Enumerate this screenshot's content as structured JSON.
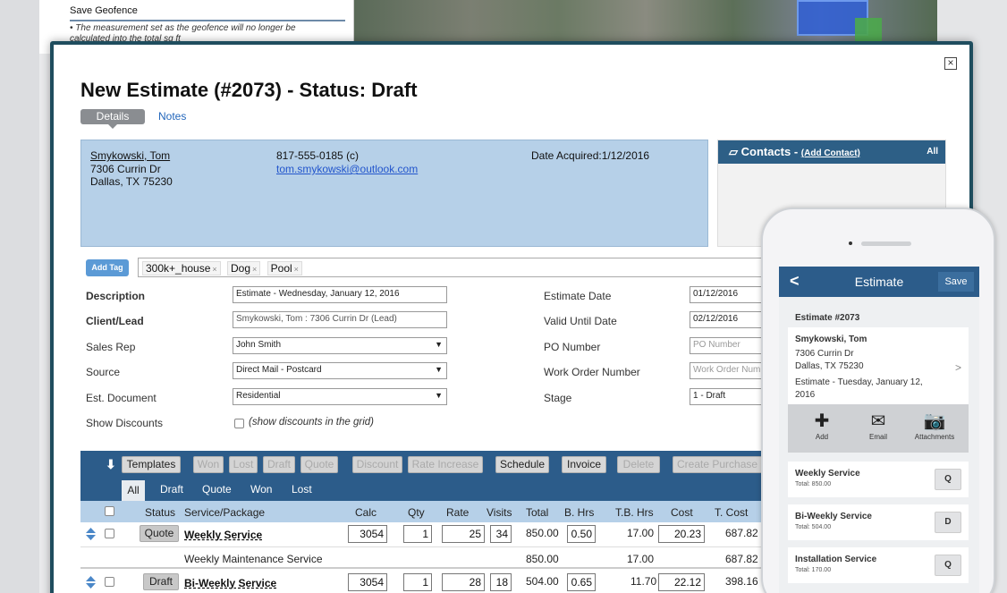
{
  "background": {
    "panel_title": "Save Geofence",
    "panel_note": "• The measurement set as the geofence will no longer be calculated into the total sq ft"
  },
  "modal": {
    "title": "New Estimate (#2073) - Status: Draft",
    "close_icon": "×",
    "tabs": {
      "details": "Details",
      "notes": "Notes"
    },
    "client": {
      "name": "Smykowski, Tom",
      "address1": "7306 Currin Dr",
      "address2": "Dallas, TX 75230",
      "phone": "817-555-0185 (c)",
      "email": "tom.smykowski@outlook.com",
      "date_acquired": "Date Acquired:1/12/2016"
    },
    "contacts": {
      "title": "Contacts - ",
      "add": "(Add Contact)",
      "all": "All"
    },
    "tags": {
      "button": "Add Tag",
      "items": [
        "300k+_house",
        "Dog",
        "Pool"
      ],
      "remove_glyph": "×"
    },
    "form": {
      "description_label": "Description",
      "description_value": "Estimate - Wednesday, January 12, 2016",
      "client_label": "Client/Lead",
      "client_value": "Smykowski, Tom : 7306 Currin Dr (Lead)",
      "sales_rep_label": "Sales Rep",
      "sales_rep_value": "John Smith",
      "source_label": "Source",
      "source_value": "Direct Mail - Postcard",
      "est_doc_label": "Est. Document",
      "est_doc_value": "Residential",
      "show_discounts_label": "Show Discounts",
      "show_discounts_text": "(show discounts in the grid)",
      "estimate_date_label": "Estimate Date",
      "estimate_date_value": "01/12/2016",
      "valid_until_label": "Valid Until Date",
      "valid_until_value": "02/12/2016",
      "po_label": "PO Number",
      "po_placeholder": "PO Number",
      "wo_label": "Work Order Number",
      "wo_placeholder": "Work Order Num",
      "stage_label": "Stage",
      "stage_value": "1 - Draft"
    },
    "toolbar": {
      "arrow": "⬇",
      "buttons": [
        "Templates",
        "Won",
        "Lost",
        "Draft",
        "Quote",
        "Discount",
        "Rate Increase",
        "Schedule",
        "Invoice",
        "Delete",
        "Create Purchase O"
      ],
      "filters": [
        "All",
        "Draft",
        "Quote",
        "Won",
        "Lost"
      ]
    },
    "grid": {
      "headers": [
        "Status",
        "Service/Package",
        "Calc",
        "Qty",
        "Rate",
        "Visits",
        "Total",
        "B. Hrs",
        "T.B. Hrs",
        "Cost",
        "T. Cost"
      ],
      "rows": [
        {
          "status": "Quote",
          "service": "Weekly Service",
          "calc": "3054",
          "qty": "1",
          "rate": "25",
          "visits": "34",
          "total": "850.00",
          "bhrs": "0.50",
          "tbhrs": "17.00",
          "cost": "20.23",
          "tcost": "687.82"
        },
        {
          "sub": "Weekly Maintenance Service",
          "total": "850.00",
          "tbhrs": "17.00",
          "tcost": "687.82"
        },
        {
          "status": "Draft",
          "service": "Bi-Weekly Service",
          "calc": "3054",
          "qty": "1",
          "rate": "28",
          "visits": "18",
          "total": "504.00",
          "bhrs": "0.65",
          "tbhrs": "11.70",
          "cost": "22.12",
          "tcost": "398.16"
        }
      ]
    }
  },
  "phone": {
    "header_title": "Estimate",
    "back": "<",
    "save": "Save",
    "estimate_no": "Estimate #2073",
    "client_name": "Smykowski, Tom",
    "addr1": "7306 Currin Dr",
    "addr2": "Dallas, TX 75230",
    "desc1": "Estimate - Tuesday, January 12,",
    "desc2": "2016",
    "chevron": ">",
    "actions": [
      {
        "icon": "✚",
        "label": "Add"
      },
      {
        "icon": "✉",
        "label": "Email"
      },
      {
        "icon": "📷",
        "label": "Attachments"
      }
    ],
    "services": [
      {
        "name": "Weekly Service",
        "total": "Total: 850.00",
        "badge": "Q"
      },
      {
        "name": "Bi-Weekly Service",
        "total": "Total: 504.00",
        "badge": "D"
      },
      {
        "name": "Installation Service",
        "total": "Total: 170.00",
        "badge": "Q"
      }
    ]
  }
}
